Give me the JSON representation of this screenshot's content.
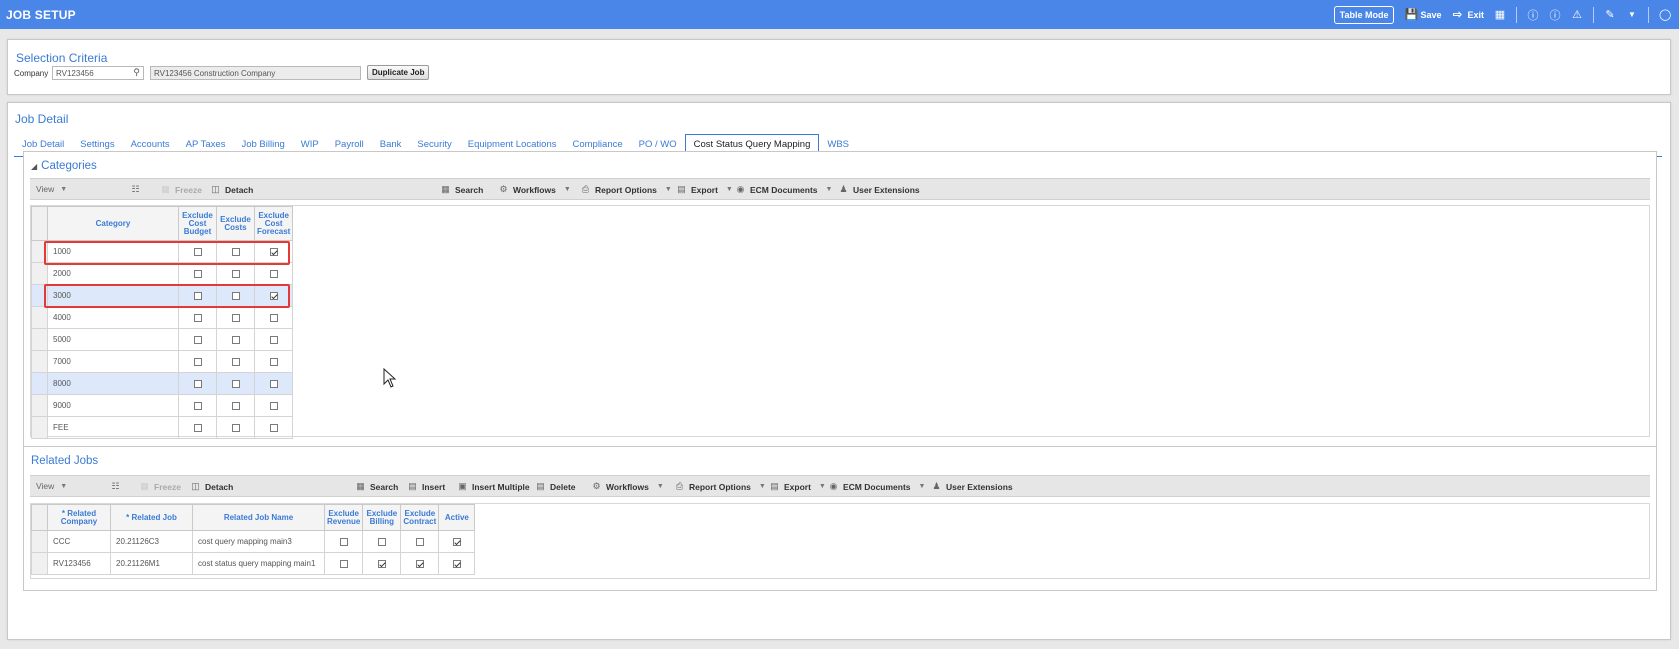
{
  "app": {
    "title": "JOB SETUP",
    "table_mode_label": "Table Mode",
    "save_label": "Save",
    "exit_label": "Exit"
  },
  "selection": {
    "title": "Selection Criteria",
    "company_label": "Company",
    "company_value": "RV123456",
    "company_name": "RV123456  Construction Company",
    "duplicate_label": "Duplicate Job"
  },
  "job_detail": {
    "title": "Job Detail",
    "tabs": [
      "Job Detail",
      "Settings",
      "Accounts",
      "AP Taxes",
      "Job Billing",
      "WIP",
      "Payroll",
      "Bank",
      "Security",
      "Equipment Locations",
      "Compliance",
      "PO / WO",
      "Cost Status Query Mapping",
      "WBS"
    ],
    "active_tab": "Cost Status Query Mapping"
  },
  "categories": {
    "title": "Categories",
    "toolbar": {
      "view": "View",
      "freeze": "Freeze",
      "detach": "Detach",
      "search": "Search",
      "workflows": "Workflows",
      "report_options": "Report Options",
      "export": "Export",
      "ecm": "ECM Documents",
      "user_ext": "User Extensions"
    },
    "columns": {
      "category": "Category",
      "exclude_cost_budget": [
        "Exclude",
        "Cost",
        "Budget"
      ],
      "exclude_costs": [
        "Exclude",
        "Costs"
      ],
      "exclude_cost_forecast": [
        "Exclude",
        "Cost",
        "Forecast"
      ]
    },
    "rows": [
      {
        "category": "1000",
        "budget": false,
        "costs": false,
        "forecast": true,
        "selected": false
      },
      {
        "category": "2000",
        "budget": false,
        "costs": false,
        "forecast": false,
        "selected": false
      },
      {
        "category": "3000",
        "budget": false,
        "costs": false,
        "forecast": true,
        "selected": true
      },
      {
        "category": "4000",
        "budget": false,
        "costs": false,
        "forecast": false,
        "selected": false
      },
      {
        "category": "5000",
        "budget": false,
        "costs": false,
        "forecast": false,
        "selected": false
      },
      {
        "category": "7000",
        "budget": false,
        "costs": false,
        "forecast": false,
        "selected": false
      },
      {
        "category": "8000",
        "budget": false,
        "costs": false,
        "forecast": false,
        "selected": true
      },
      {
        "category": "9000",
        "budget": false,
        "costs": false,
        "forecast": false,
        "selected": false
      },
      {
        "category": "FEE",
        "budget": false,
        "costs": false,
        "forecast": false,
        "selected": false
      }
    ]
  },
  "related_jobs": {
    "title": "Related Jobs",
    "toolbar": {
      "view": "View",
      "freeze": "Freeze",
      "detach": "Detach",
      "search": "Search",
      "insert": "Insert",
      "insert_multiple": "Insert Multiple",
      "delete": "Delete",
      "workflows": "Workflows",
      "report_options": "Report Options",
      "export": "Export",
      "ecm": "ECM Documents",
      "user_ext": "User Extensions"
    },
    "columns": {
      "related_company": [
        "* Related",
        "Company"
      ],
      "related_job": "* Related Job",
      "related_job_name": "Related Job Name",
      "exclude_revenue": [
        "Exclude",
        "Revenue"
      ],
      "exclude_billing": [
        "Exclude",
        "Billing"
      ],
      "exclude_contract": [
        "Exclude",
        "Contract"
      ],
      "active": "Active"
    },
    "rows": [
      {
        "company": "CCC",
        "job": "20.21126C3",
        "name": "cost query mapping main3",
        "revenue": false,
        "billing": false,
        "contract": false,
        "active": true
      },
      {
        "company": "RV123456",
        "job": "20.21126M1",
        "name": "cost status query mapping main1",
        "revenue": false,
        "billing": true,
        "contract": true,
        "active": true
      }
    ]
  },
  "colors": {
    "title_bar": "#4a86e8",
    "accent": "#3a7bd5",
    "highlight": "#e53935",
    "selected_row": "#dde9fb"
  }
}
